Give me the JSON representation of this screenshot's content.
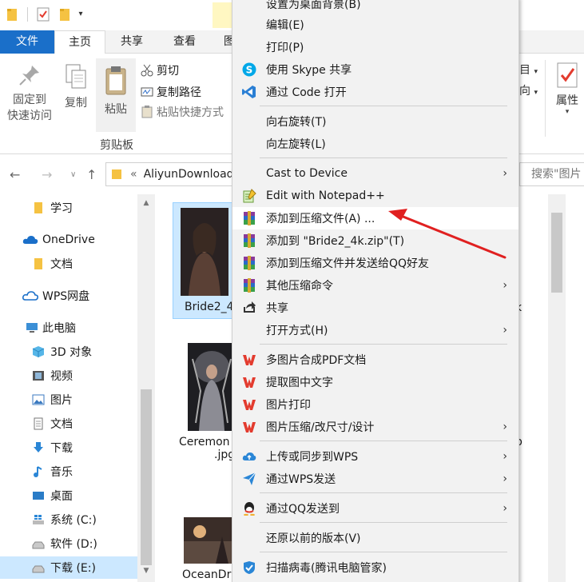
{
  "quick_access": {
    "dropdown_glyph": "▾"
  },
  "ribbon_tabs": {
    "file": "文件",
    "home": "主页",
    "share": "共享",
    "view": "查看",
    "partial": "图"
  },
  "ribbon": {
    "pin_label_1": "固定到",
    "pin_label_2": "快速访问",
    "copy_label": "复制",
    "paste_label": "粘贴",
    "cut_label": "剪切",
    "copy_path_label": "复制路径",
    "paste_shortcut_label": "粘贴快捷方式",
    "clipboard_group": "剪贴板",
    "right_label_1": "目",
    "right_label_2": "向",
    "right_arrow_1": "▾",
    "right_arrow_2": "▾",
    "properties_label": "属性",
    "properties_arrow": "▾"
  },
  "address_bar": {
    "back": "←",
    "forward": "→",
    "recent": "∨",
    "up": "↑",
    "chevron": "«",
    "path": "AliyunDownload",
    "search_placeholder": "搜索\"图片"
  },
  "sidebar": {
    "items": [
      {
        "label": "学习",
        "icon": "folder-icon"
      },
      {
        "label": "OneDrive",
        "icon": "onedrive-cloud-icon"
      },
      {
        "label": "文档",
        "icon": "folder-icon"
      },
      {
        "label": "WPS网盘",
        "icon": "wps-cloud-icon"
      },
      {
        "label": "此电脑",
        "icon": "computer-icon"
      },
      {
        "label": "3D 对象",
        "icon": "3d-objects-icon"
      },
      {
        "label": "视频",
        "icon": "video-icon"
      },
      {
        "label": "图片",
        "icon": "pictures-icon"
      },
      {
        "label": "文档",
        "icon": "documents-icon"
      },
      {
        "label": "下载",
        "icon": "download-icon"
      },
      {
        "label": "音乐",
        "icon": "music-icon"
      },
      {
        "label": "桌面",
        "icon": "desktop-icon"
      },
      {
        "label": "系统 (C:)",
        "icon": "windows-drive-icon"
      },
      {
        "label": "软件 (D:)",
        "icon": "drive-icon"
      },
      {
        "label": "下载 (E:)",
        "icon": "drive-icon"
      }
    ]
  },
  "files": {
    "tile1_name": "Bride2_4",
    "tile2_name": "Ceremon",
    "tile2_ext": ".jpg",
    "tile3_name": "OceanDr",
    "side_text_1": "k",
    "side_text_2": "p"
  },
  "context_menu": {
    "items": [
      {
        "label": "设置为桌面背景(B)",
        "icon": "",
        "submenu": false
      },
      {
        "label": "编辑(E)",
        "icon": "",
        "submenu": false
      },
      {
        "label": "打印(P)",
        "icon": "",
        "submenu": false
      },
      {
        "label": "使用 Skype 共享",
        "icon": "skype-icon",
        "submenu": false
      },
      {
        "label": "通过 Code 打开",
        "icon": "vscode-icon",
        "submenu": false
      },
      {
        "label": "向右旋转(T)",
        "icon": "",
        "submenu": false
      },
      {
        "label": "向左旋转(L)",
        "icon": "",
        "submenu": false
      },
      {
        "label": "Cast to Device",
        "icon": "",
        "submenu": true
      },
      {
        "label": "Edit with Notepad++",
        "icon": "notepadpp-icon",
        "submenu": false
      },
      {
        "label": "添加到压缩文件(A) ...",
        "icon": "winrar-icon",
        "submenu": false
      },
      {
        "label": "添加到 \"Bride2_4k.zip\"(T)",
        "icon": "winrar-icon",
        "submenu": false
      },
      {
        "label": "添加到压缩文件并发送给QQ好友",
        "icon": "winrar-icon",
        "submenu": false
      },
      {
        "label": "其他压缩命令",
        "icon": "winrar-icon",
        "submenu": true
      },
      {
        "label": "共享",
        "icon": "share-icon",
        "submenu": false
      },
      {
        "label": "打开方式(H)",
        "icon": "",
        "submenu": true
      },
      {
        "label": "多图片合成PDF文档",
        "icon": "wps-icon",
        "submenu": false
      },
      {
        "label": "提取图中文字",
        "icon": "wps-icon",
        "submenu": false
      },
      {
        "label": "图片打印",
        "icon": "wps-icon",
        "submenu": false
      },
      {
        "label": "图片压缩/改尺寸/设计",
        "icon": "wps-icon",
        "submenu": true
      },
      {
        "label": "上传或同步到WPS",
        "icon": "wps-cloud-upload-icon",
        "submenu": true
      },
      {
        "label": "通过WPS发送",
        "icon": "wps-send-icon",
        "submenu": true
      },
      {
        "label": "通过QQ发送到",
        "icon": "qq-icon",
        "submenu": true
      },
      {
        "label": "还原以前的版本(V)",
        "icon": "",
        "submenu": false
      },
      {
        "label": "扫描病毒(腾讯电脑管家)",
        "icon": "tencent-shield-icon",
        "submenu": false
      }
    ],
    "submenu_glyph": "›"
  },
  "colors": {
    "file_tab": "#1a6fc9",
    "selection": "#cce8ff",
    "menu_bg": "#f2f2f2",
    "arrow_red": "#e02020",
    "folder": "#f5c242",
    "wps_red": "#e33b2e"
  }
}
